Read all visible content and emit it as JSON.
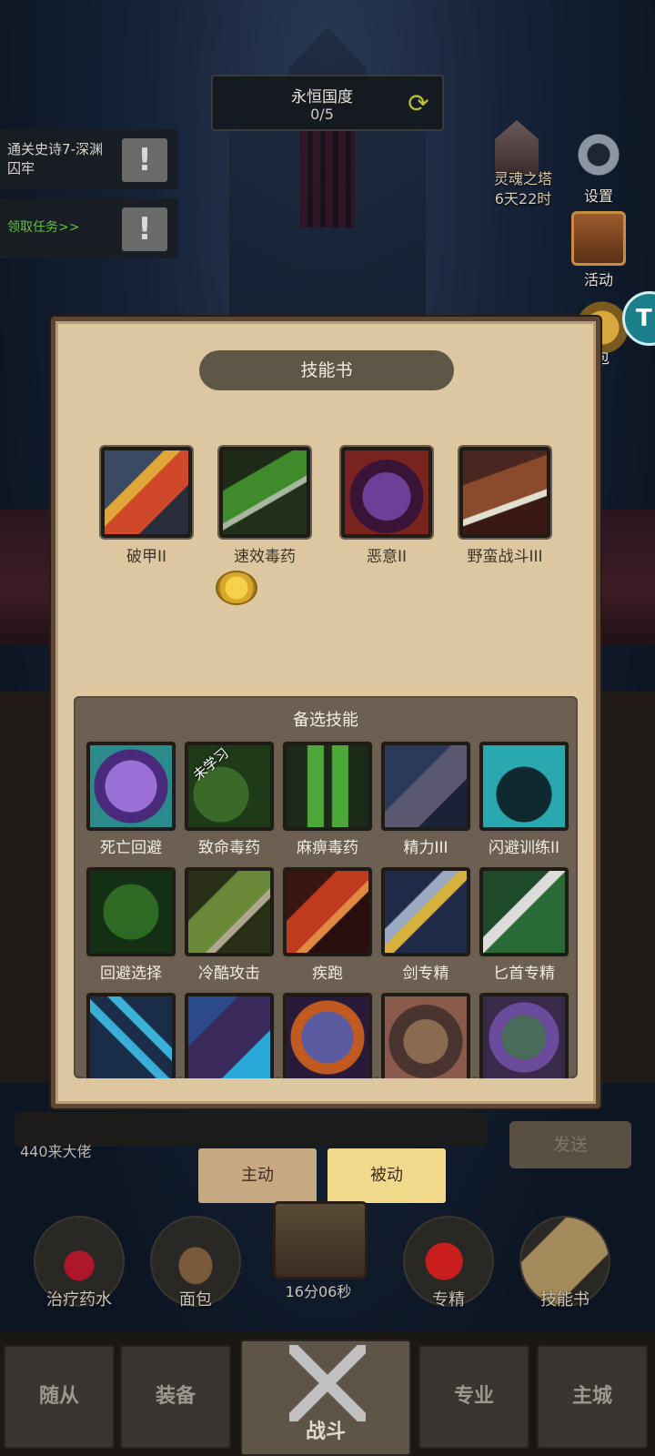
{
  "top": {
    "realm_title": "永恒国度",
    "realm_progress": "0/5",
    "quests": [
      {
        "text": "通关史诗7-深渊囚牢"
      },
      {
        "text": "领取任务>>"
      }
    ],
    "tower_name": "灵魂之塔",
    "tower_timer": "6天22时",
    "settings_label": "设置",
    "events_label": "活动",
    "bag_label": "包",
    "teal_badge": "T"
  },
  "panel": {
    "title": "技能书",
    "equipped": [
      {
        "name": "破甲II",
        "icon": "armor-break-icon"
      },
      {
        "name": "速效毒药",
        "icon": "quick-poison-icon"
      },
      {
        "name": "恶意II",
        "icon": "malice-icon"
      },
      {
        "name": "野蛮战斗III",
        "icon": "savage-combat-icon"
      }
    ],
    "alt_title": "备选技能",
    "alt_skills": [
      {
        "name": "死亡回避",
        "icon": "death-evade-icon"
      },
      {
        "name": "致命毒药",
        "icon": "deadly-poison-icon",
        "badge": "未学习"
      },
      {
        "name": "麻痹毒药",
        "icon": "paralysis-poison-icon"
      },
      {
        "name": "精力III",
        "icon": "vigor-icon"
      },
      {
        "name": "闪避训练II",
        "icon": "dodge-training-icon"
      },
      {
        "name": "回避选择",
        "icon": "evade-choice-icon"
      },
      {
        "name": "冷酷攻击",
        "icon": "ruthless-attack-icon"
      },
      {
        "name": "疾跑",
        "icon": "sprint-icon"
      },
      {
        "name": "剑专精",
        "icon": "sword-mastery-icon"
      },
      {
        "name": "匕首专精",
        "icon": "dagger-mastery-icon"
      },
      {
        "name": "",
        "icon": "crossed-blades-icon"
      },
      {
        "name": "",
        "icon": "hooded-figure-icon"
      },
      {
        "name": "",
        "icon": "stone-face-icon"
      },
      {
        "name": "",
        "icon": "dwarf-icon"
      },
      {
        "name": "",
        "icon": "goblin-icon"
      }
    ]
  },
  "chat": {
    "input_text": "440来大佬",
    "send_label": "发送"
  },
  "toggles": {
    "active_label": "主动",
    "passive_label": "被动"
  },
  "actions": {
    "potion": "治疗药水",
    "bread": "面包",
    "chest_timer": "16分06秒",
    "specialize": "专精",
    "skillbook": "技能书"
  },
  "nav": {
    "followers": "随从",
    "equipment": "装备",
    "battle": "战斗",
    "profession": "专业",
    "main_city": "主城"
  }
}
